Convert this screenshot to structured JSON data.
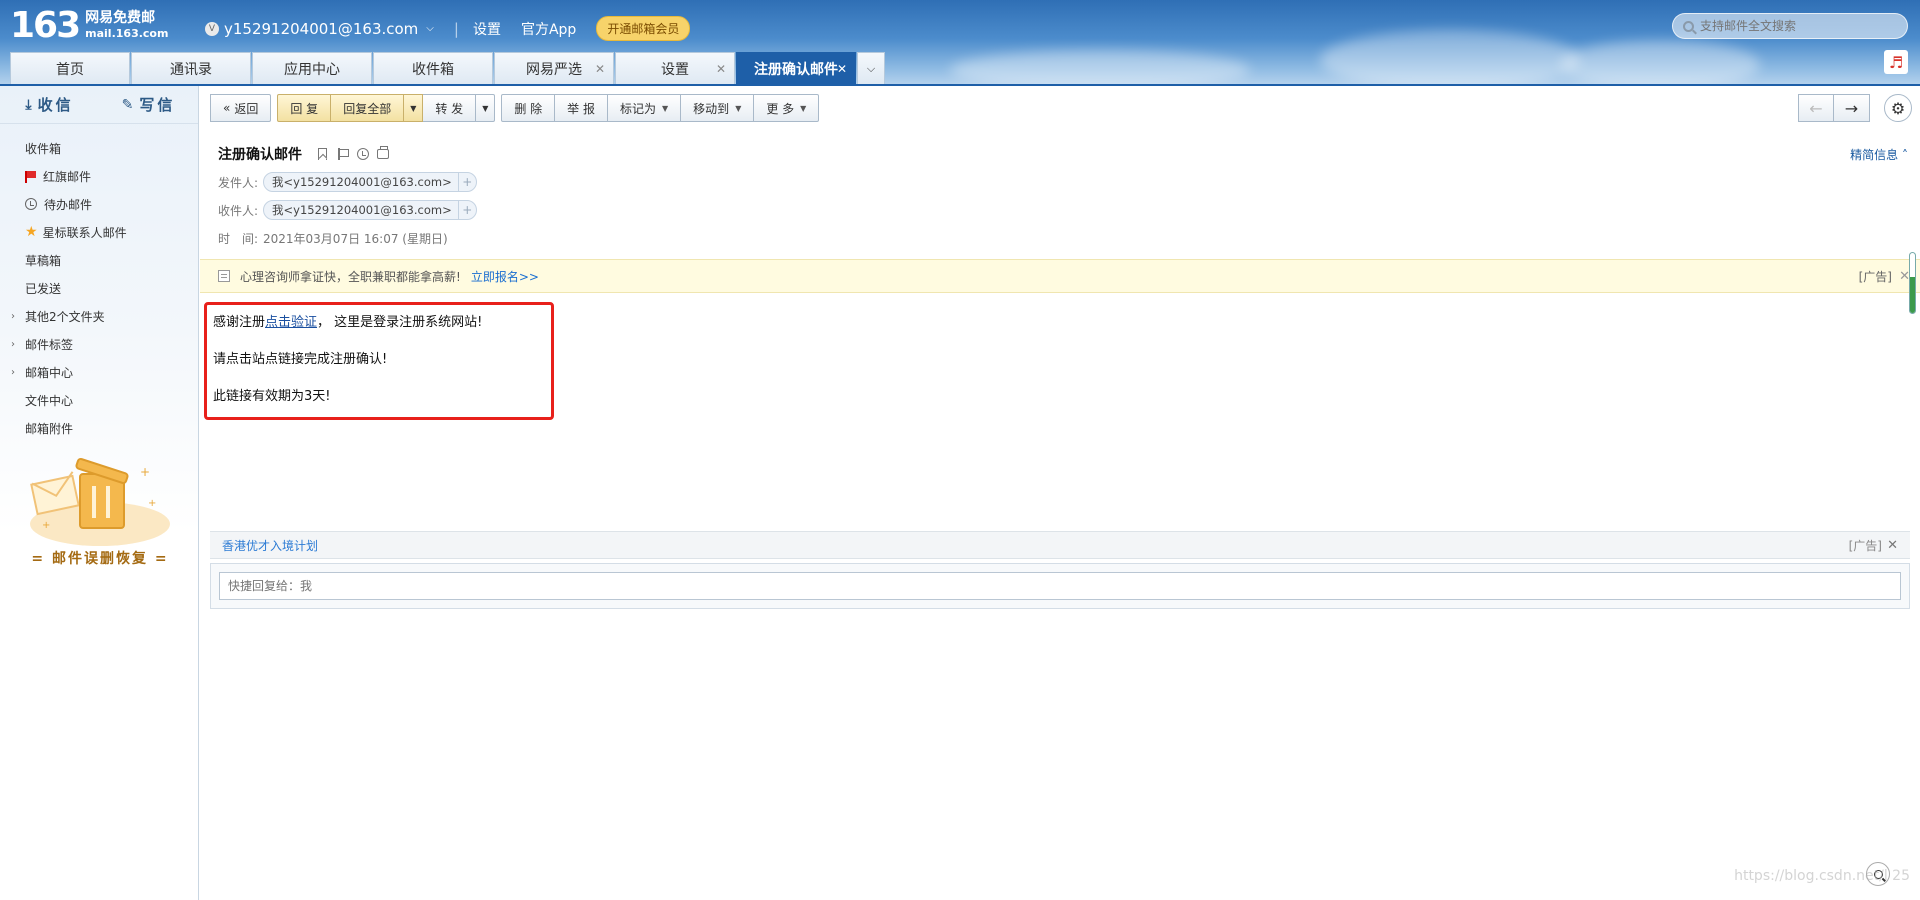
{
  "header": {
    "logo_num": "163",
    "logo_line1": "网易免费邮",
    "logo_line2": "mail.163.com",
    "account_badge": "V",
    "account": "y15291204001@163.com",
    "settings_link": "设置",
    "app_link": "官方App",
    "vip_button": "开通邮箱会员",
    "search_placeholder": "支持邮件全文搜索",
    "music_icon": "♬"
  },
  "tabs": [
    {
      "label": "首页",
      "closable": false
    },
    {
      "label": "通讯录",
      "closable": false
    },
    {
      "label": "应用中心",
      "closable": false
    },
    {
      "label": "收件箱",
      "closable": false
    },
    {
      "label": "网易严选",
      "closable": true
    },
    {
      "label": "设置",
      "closable": true
    },
    {
      "label": "注册确认邮件",
      "closable": true,
      "active": true
    }
  ],
  "sidebar": {
    "receive": "收信",
    "compose": "写信",
    "items": [
      {
        "label": "收件箱"
      },
      {
        "label": "红旗邮件"
      },
      {
        "label": "待办邮件"
      },
      {
        "label": "星标联系人邮件"
      },
      {
        "label": "草稿箱"
      },
      {
        "label": "已发送"
      },
      {
        "label": "其他2个文件夹"
      },
      {
        "label": "邮件标签"
      },
      {
        "label": "邮箱中心"
      },
      {
        "label": "文件中心"
      },
      {
        "label": "邮箱附件"
      }
    ],
    "promo_text": "= 邮件误删恢复 ="
  },
  "toolbar": {
    "back": "返回",
    "reply": "回 复",
    "reply_all": "回复全部",
    "forward": "转 发",
    "delete": "删 除",
    "report": "举 报",
    "mark_as": "标记为",
    "move_to": "移动到",
    "more": "更 多"
  },
  "mail": {
    "subject": "注册确认邮件",
    "detail_link": "精简信息",
    "from_label": "发件人:",
    "from": "我<y15291204001@163.com>",
    "to_label": "收件人:",
    "to": "我<y15291204001@163.com>",
    "time_label": "时　间:",
    "time": "2021年03月07日 16:07 (星期日)",
    "body": {
      "line1_prefix": "感谢注册",
      "line1_link": "点击验证",
      "line1_suffix": "， 这里是登录注册系统网站!",
      "line2": "请点击站点链接完成注册确认!",
      "line3": "此链接有效期为3天!"
    }
  },
  "ad_top": {
    "text": "心理咨询师拿证快，全职兼职都能拿高薪!",
    "link": "立即报名>>",
    "tag": "[广告]",
    "close": "✕"
  },
  "ad_bottom": {
    "text": "香港优才入境计划",
    "tag": "[广告]",
    "close": "✕"
  },
  "reply_box": {
    "placeholder": "快捷回复给：我"
  },
  "watermark": "https://blog.csdn.net/l    25"
}
